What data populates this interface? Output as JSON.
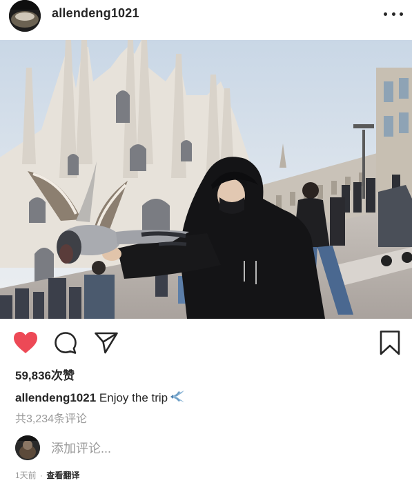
{
  "post": {
    "username": "allendeng1021",
    "likes_text": "59,836次赞",
    "caption_user": "allendeng1021",
    "caption_text": "Enjoy the trip",
    "comments_link": "共3,234条评论",
    "add_comment_placeholder": "添加评论...",
    "time_ago": "1天前",
    "separator": "·",
    "translate_label": "查看翻译"
  },
  "icons": {
    "more": "more-options-icon",
    "like": "heart-icon",
    "comment": "comment-icon",
    "share": "paper-plane-icon",
    "save": "bookmark-icon",
    "caption_emoji": "airplane-emoji"
  },
  "colors": {
    "like_red": "#ed4956",
    "text": "#262626",
    "muted": "#999999"
  }
}
